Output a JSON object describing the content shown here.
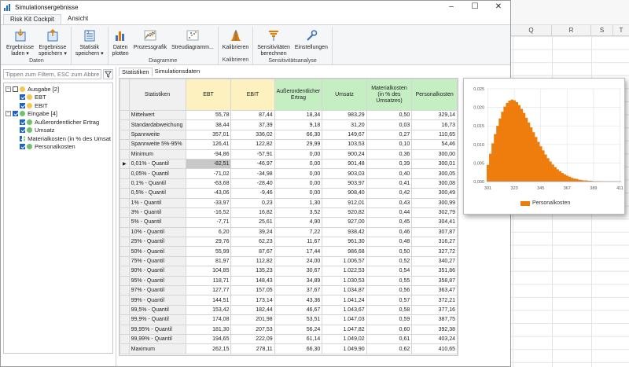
{
  "window": {
    "title": "Simulationsergebnisse",
    "controls": [
      "–",
      "☐",
      "✕"
    ]
  },
  "ribbon": {
    "tabs": [
      "Risk Kit Cockpit",
      "Ansicht"
    ],
    "groups": [
      {
        "label": "Daten",
        "buttons": [
          {
            "name": "ergebnisse-laden-button",
            "l1": "Ergebnisse",
            "l2": "laden ▾",
            "icon": "load-results-icon"
          },
          {
            "name": "ergebnisse-speichern-button",
            "l1": "Ergebnisse",
            "l2": "speichern ▾",
            "icon": "save-results-icon"
          }
        ]
      },
      {
        "label": "",
        "buttons": [
          {
            "name": "statistik-speichern-button",
            "l1": "Statistik",
            "l2": "speichern ▾",
            "icon": "save-statistics-icon"
          }
        ]
      },
      {
        "label": "Diagramme",
        "buttons": [
          {
            "name": "daten-plotten-button",
            "l1": "Daten",
            "l2": "plotten",
            "icon": "bar-chart-icon"
          },
          {
            "name": "prozessgrafik-button",
            "l1": "Prozessgrafik",
            "l2": "",
            "icon": "process-chart-icon"
          },
          {
            "name": "streudiagramm-button",
            "l1": "Streudiagramm...",
            "l2": "",
            "icon": "scatter-chart-icon"
          }
        ]
      },
      {
        "label": "Kalibrieren",
        "buttons": [
          {
            "name": "kalibrieren-button",
            "l1": "Kalibrieren",
            "l2": "",
            "icon": "calibrate-icon"
          }
        ]
      },
      {
        "label": "Sensitivitätsanalyse",
        "buttons": [
          {
            "name": "sensitivitaeten-button",
            "l1": "Sensitivitäten",
            "l2": "berechnen",
            "icon": "sensitivity-icon"
          },
          {
            "name": "einstellungen-button",
            "l1": "Einstellungen",
            "l2": "",
            "icon": "settings-wrench-icon"
          }
        ]
      }
    ]
  },
  "filter": {
    "placeholder": "Tippen zum Filtern, ESC zum Abbre"
  },
  "tree": [
    {
      "label": "Ausgabe [2]",
      "level": 0,
      "toggle": "⊟",
      "checked": false,
      "dot": "#f2c94c"
    },
    {
      "label": "EBT",
      "level": 1,
      "checked": true,
      "dot": "#f2c94c"
    },
    {
      "label": "EBIT",
      "level": 1,
      "checked": true,
      "dot": "#f2c94c"
    },
    {
      "label": "Eingabe [4]",
      "level": 0,
      "toggle": "⊟",
      "checked": true,
      "dot": "#6cc46a"
    },
    {
      "label": "Außerordentlicher Ertrag",
      "level": 1,
      "checked": true,
      "dot": "#6cc46a"
    },
    {
      "label": "Umsatz",
      "level": 1,
      "checked": true,
      "dot": "#6cc46a"
    },
    {
      "label": "Materialkosten (in % des Umsat",
      "level": 1,
      "checked": true,
      "dot": "#6cc46a"
    },
    {
      "label": "Personalkosten",
      "level": 1,
      "checked": true,
      "dot": "#6cc46a"
    }
  ],
  "subtabs": [
    "Statistiken",
    "Simulationsdaten"
  ],
  "table": {
    "header_stat": "Statistiken",
    "columns": [
      {
        "label": "EBT",
        "kind": "out"
      },
      {
        "label": "EBIT",
        "kind": "out"
      },
      {
        "label": "Außerordentlicher Ertrag",
        "kind": "inp"
      },
      {
        "label": "Umsatz",
        "kind": "inp"
      },
      {
        "label": "Materialkosten (in % des Umsatzes)",
        "kind": "inp"
      },
      {
        "label": "Personalkosten",
        "kind": "inp"
      }
    ],
    "current_row_marker": "▶",
    "rows": [
      {
        "name": "Mittelwert",
        "v": [
          "55,78",
          "87,44",
          "18,34",
          "983,29",
          "0,50",
          "329,14"
        ]
      },
      {
        "name": "Standardabweichung",
        "v": [
          "38,44",
          "37,39",
          "9,18",
          "31,20",
          "0,03",
          "16,73"
        ]
      },
      {
        "name": "Spannweite",
        "v": [
          "357,01",
          "336,02",
          "66,30",
          "149,67",
          "0,27",
          "110,65"
        ]
      },
      {
        "name": "Spannweite 5%-95%",
        "v": [
          "126,41",
          "122,82",
          "29,99",
          "103,53",
          "0,10",
          "54,46"
        ]
      },
      {
        "name": "Minimum",
        "v": [
          "-94,86",
          "-57,91",
          "0,00",
          "900,24",
          "0,36",
          "300,00"
        ]
      },
      {
        "name": "0,01% - Quantil",
        "v": [
          "-82,51",
          "-46,97",
          "0,00",
          "901,48",
          "0,39",
          "300,01"
        ]
      },
      {
        "name": "0,05% - Quantil",
        "v": [
          "-71,02",
          "-34,98",
          "0,00",
          "903,03",
          "0,40",
          "300,05"
        ]
      },
      {
        "name": "0,1% - Quantil",
        "v": [
          "-63,68",
          "-28,40",
          "0,00",
          "903,97",
          "0,41",
          "300,08"
        ]
      },
      {
        "name": "0,5% - Quantil",
        "v": [
          "-43,06",
          "-9,46",
          "0,00",
          "908,40",
          "0,42",
          "300,49"
        ]
      },
      {
        "name": "1% - Quantil",
        "v": [
          "-33,97",
          "0,23",
          "1,30",
          "912,01",
          "0,43",
          "300,99"
        ]
      },
      {
        "name": "3% - Quantil",
        "v": [
          "-16,52",
          "16,82",
          "3,52",
          "920,82",
          "0,44",
          "302,79"
        ]
      },
      {
        "name": "5% - Quantil",
        "v": [
          "-7,71",
          "25,61",
          "4,90",
          "927,00",
          "0,45",
          "304,41"
        ]
      },
      {
        "name": "10% - Quantil",
        "v": [
          "6,20",
          "39,24",
          "7,22",
          "938,42",
          "0,46",
          "307,87"
        ]
      },
      {
        "name": "25% - Quantil",
        "v": [
          "29,76",
          "62,23",
          "11,67",
          "961,30",
          "0,48",
          "316,27"
        ]
      },
      {
        "name": "50% - Quantil",
        "v": [
          "55,99",
          "87,67",
          "17,44",
          "986,68",
          "0,50",
          "327,72"
        ]
      },
      {
        "name": "75% - Quantil",
        "v": [
          "81,97",
          "112,82",
          "24,00",
          "1.006,57",
          "0,52",
          "340,27"
        ]
      },
      {
        "name": "90% - Quantil",
        "v": [
          "104,85",
          "135,23",
          "30,67",
          "1.022,53",
          "0,54",
          "351,86"
        ]
      },
      {
        "name": "95% - Quantil",
        "v": [
          "118,71",
          "148,43",
          "34,89",
          "1.030,53",
          "0,55",
          "358,87"
        ]
      },
      {
        "name": "97% - Quantil",
        "v": [
          "127,77",
          "157,05",
          "37,67",
          "1.034,87",
          "0,56",
          "363,47"
        ]
      },
      {
        "name": "99% - Quantil",
        "v": [
          "144,51",
          "173,14",
          "43,36",
          "1.041,24",
          "0,57",
          "372,21"
        ]
      },
      {
        "name": "99,5% - Quantil",
        "v": [
          "153,42",
          "182,44",
          "46,67",
          "1.043,67",
          "0,58",
          "377,16"
        ]
      },
      {
        "name": "99,9% - Quantil",
        "v": [
          "174,08",
          "201,98",
          "53,51",
          "1.047,03",
          "0,59",
          "387,75"
        ]
      },
      {
        "name": "99,95% - Quantil",
        "v": [
          "181,30",
          "207,53",
          "56,24",
          "1.047,82",
          "0,60",
          "392,38"
        ]
      },
      {
        "name": "99,99% - Quantil",
        "v": [
          "194,65",
          "222,09",
          "61,14",
          "1.049,02",
          "0,61",
          "403,24"
        ]
      },
      {
        "name": "Maximum",
        "v": [
          "262,15",
          "278,11",
          "66,30",
          "1.049,90",
          "0,62",
          "410,65"
        ]
      }
    ]
  },
  "spreadsheet": {
    "columns": [
      "Q",
      "R",
      "S",
      "T"
    ]
  },
  "chart_data": {
    "type": "bar",
    "series": [
      {
        "name": "Personalkosten",
        "x": [
          301,
          303,
          305,
          307,
          309,
          311,
          313,
          315,
          317,
          319,
          321,
          323,
          325,
          327,
          329,
          331,
          333,
          335,
          337,
          339,
          341,
          343,
          345,
          347,
          349,
          351,
          353,
          355,
          357,
          359,
          361,
          363,
          365,
          367,
          369,
          371,
          373,
          375,
          377,
          379,
          381,
          383,
          385,
          387,
          389,
          391,
          393,
          395,
          397,
          399,
          401,
          403,
          405,
          407,
          409,
          411
        ],
        "values": [
          0.0045,
          0.0075,
          0.0103,
          0.0128,
          0.015,
          0.017,
          0.0188,
          0.0202,
          0.0212,
          0.0218,
          0.0221,
          0.0219,
          0.0214,
          0.0206,
          0.0196,
          0.0185,
          0.0172,
          0.0159,
          0.0146,
          0.0133,
          0.012,
          0.0107,
          0.0095,
          0.0084,
          0.0073,
          0.0063,
          0.0054,
          0.0046,
          0.0039,
          0.0033,
          0.0028,
          0.0023,
          0.0019,
          0.0016,
          0.0013,
          0.001,
          0.0008,
          0.0007,
          0.0005,
          0.0004,
          0.0003,
          0.0003,
          0.0002,
          0.0002,
          0.0001,
          0.0001,
          0.0001,
          0.0001,
          0.0,
          0.0,
          0.0,
          0.0,
          0.0,
          0.0,
          0.0,
          0.0
        ]
      }
    ],
    "color": "#ee7d0e",
    "xticks": [
      "301",
      "323",
      "345",
      "367",
      "389",
      "411"
    ],
    "yticks": [
      "0,000",
      "0,005",
      "0,010",
      "0,015",
      "0,020",
      "0,025"
    ],
    "xlim": [
      300,
      412
    ],
    "ylim": [
      0,
      0.025
    ],
    "grid": true,
    "legend": "bottom"
  }
}
